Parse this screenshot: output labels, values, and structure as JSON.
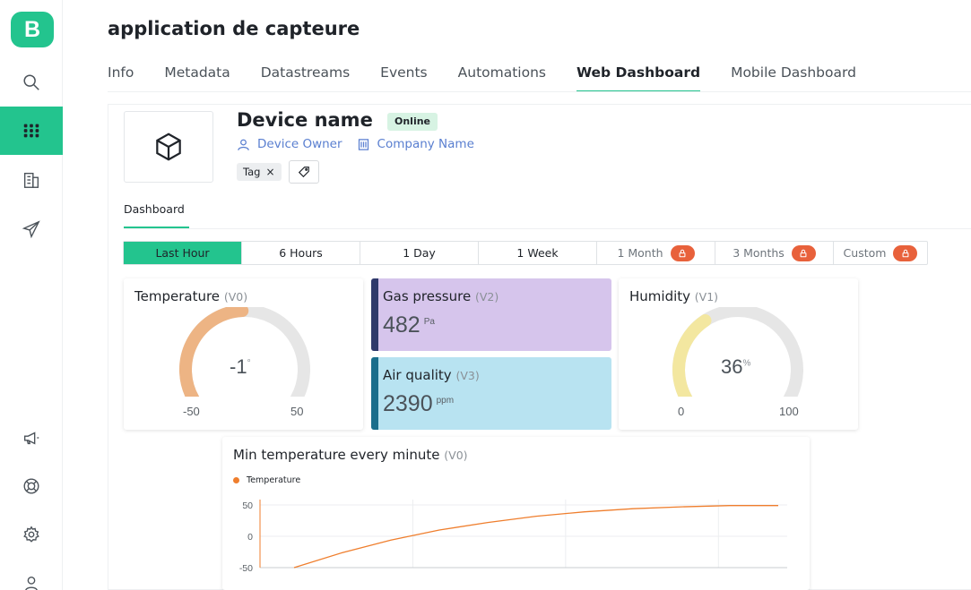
{
  "app": {
    "logo_letter": "B",
    "title": "application de capteure"
  },
  "sidebar": {
    "items": [
      {
        "name": "search",
        "icon": "search-icon",
        "active": false
      },
      {
        "name": "dashboard",
        "icon": "grid-icon",
        "active": true
      },
      {
        "name": "organizations",
        "icon": "building-icon",
        "active": false
      },
      {
        "name": "send",
        "icon": "paper-plane-icon",
        "active": false
      },
      {
        "name": "announcements",
        "icon": "megaphone-icon",
        "active": false
      },
      {
        "name": "help",
        "icon": "lifebuoy-icon",
        "active": false
      },
      {
        "name": "settings",
        "icon": "gear-icon",
        "active": false
      },
      {
        "name": "user",
        "icon": "user-icon",
        "active": false
      }
    ]
  },
  "tabs": [
    {
      "label": "Info",
      "active": false
    },
    {
      "label": "Metadata",
      "active": false
    },
    {
      "label": "Datastreams",
      "active": false
    },
    {
      "label": "Events",
      "active": false
    },
    {
      "label": "Automations",
      "active": false
    },
    {
      "label": "Web Dashboard",
      "active": true
    },
    {
      "label": "Mobile Dashboard",
      "active": false
    }
  ],
  "device": {
    "name": "Device name",
    "status": "Online",
    "owner": "Device Owner",
    "company": "Company Name",
    "tag": "Tag",
    "tag_remove": "×"
  },
  "subtab": {
    "label": "Dashboard"
  },
  "time_ranges": [
    {
      "label": "Last Hour",
      "active": true,
      "locked": false
    },
    {
      "label": "6 Hours",
      "active": false,
      "locked": false
    },
    {
      "label": "1 Day",
      "active": false,
      "locked": false
    },
    {
      "label": "1 Week",
      "active": false,
      "locked": false
    },
    {
      "label": "1 Month",
      "active": false,
      "locked": true
    },
    {
      "label": "3 Months",
      "active": false,
      "locked": true
    },
    {
      "label": "Custom",
      "active": false,
      "locked": true
    }
  ],
  "widgets": {
    "temperature": {
      "title": "Temperature",
      "pin": "(V0)",
      "value": "-1",
      "unit": "°",
      "min": "-50",
      "max": "50",
      "value_num": -1,
      "min_num": -50,
      "max_num": 50,
      "color": "#edb484"
    },
    "gas": {
      "title": "Gas pressure",
      "pin": "(V2)",
      "value": "482",
      "unit": "Pa",
      "bg": "#d6c5ec",
      "stripe": "#2f3a6b"
    },
    "air": {
      "title": "Air quality",
      "pin": "(V3)",
      "value": "2390",
      "unit": "ppm",
      "bg": "#b8e3f1",
      "stripe": "#1a6e8c"
    },
    "humidity": {
      "title": "Humidity",
      "pin": "(V1)",
      "value": "36",
      "unit": "%",
      "min": "0",
      "max": "100",
      "value_num": 36,
      "min_num": 0,
      "max_num": 100,
      "color": "#f3e7a0"
    }
  },
  "chart": {
    "title": "Min temperature every minute",
    "pin": "(V0)"
  },
  "chart_data": {
    "type": "line",
    "title": "Min temperature every minute",
    "xlabel": "",
    "ylabel": "",
    "ylim": [
      -50,
      50
    ],
    "y_ticks": [
      "50",
      "0",
      "-50"
    ],
    "series": [
      {
        "name": "Temperature",
        "color": "#ef7e2d",
        "x": [
          0,
          1,
          2,
          3,
          4,
          5,
          6,
          7,
          8,
          9,
          10
        ],
        "values": [
          -50,
          -26,
          -6,
          10,
          22,
          32,
          39,
          44,
          47,
          49,
          49
        ]
      }
    ],
    "grid": true,
    "legend": "top-left"
  }
}
